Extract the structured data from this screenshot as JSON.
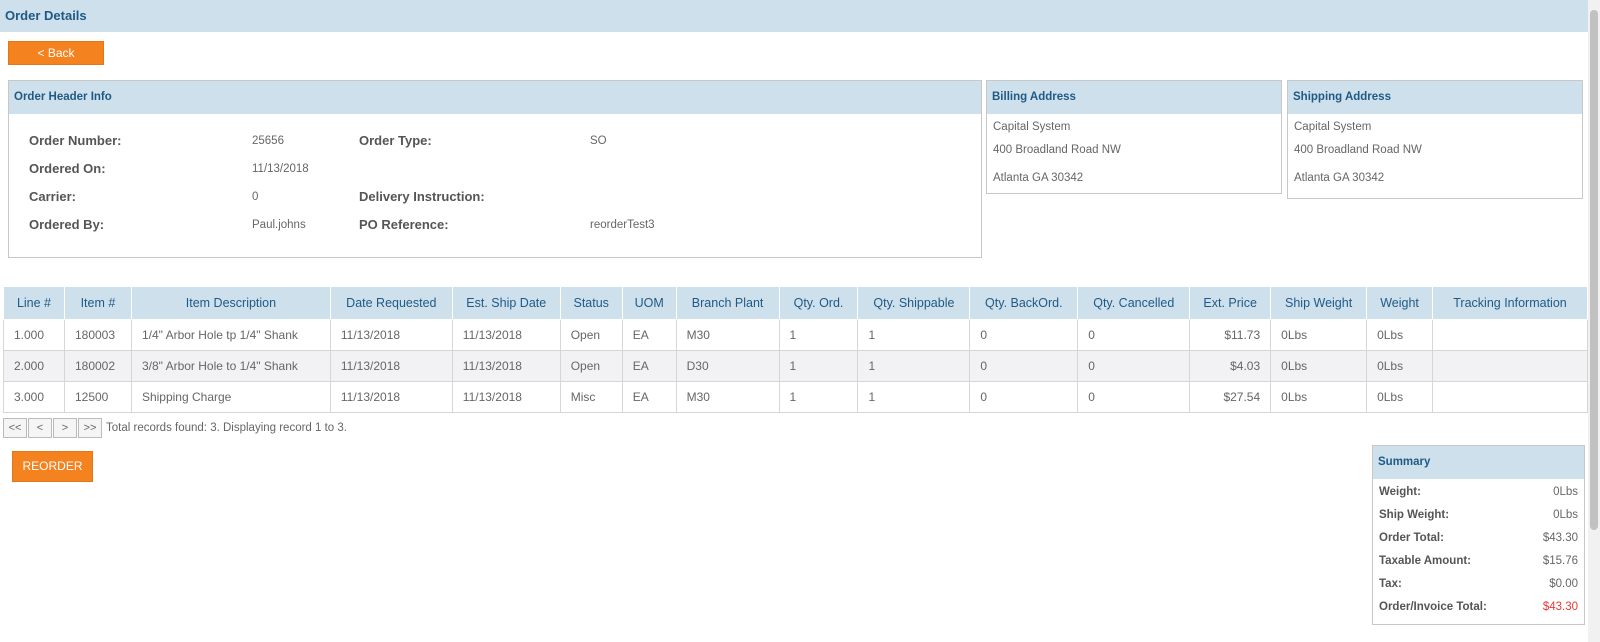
{
  "page_title": "Order Details",
  "back_label": "< Back",
  "header_info": {
    "title": "Order Header Info",
    "order_number_label": "Order Number:",
    "order_number": "25656",
    "order_type_label": "Order Type:",
    "order_type": "SO",
    "ordered_on_label": "Ordered On:",
    "ordered_on": "11/13/2018",
    "carrier_label": "Carrier:",
    "carrier": "0",
    "delivery_label": "Delivery Instruction:",
    "delivery": "",
    "ordered_by_label": "Ordered By:",
    "ordered_by": "Paul.johns",
    "po_label": "PO Reference:",
    "po": "reorderTest3"
  },
  "billing": {
    "title": "Billing Address",
    "name": "Capital System",
    "street": "400 Broadland Road NW",
    "city": "Atlanta GA 30342"
  },
  "shipping": {
    "title": "Shipping Address",
    "name": "Capital System",
    "street": "400 Broadland Road NW",
    "city": "Atlanta GA 30342"
  },
  "table": {
    "columns": [
      "Line #",
      "Item #",
      "Item Description",
      "Date Requested",
      "Est. Ship Date",
      "Status",
      "UOM",
      "Branch Plant",
      "Qty. Ord.",
      "Qty. Shippable",
      "Qty. BackOrd.",
      "Qty. Cancelled",
      "Ext. Price",
      "Ship Weight",
      "Weight",
      "Tracking Information"
    ],
    "rows": [
      [
        "1.000",
        "180003",
        "1/4\" Arbor Hole tp 1/4\" Shank",
        "11/13/2018",
        "11/13/2018",
        "Open",
        "EA",
        "M30",
        "1",
        "1",
        "0",
        "0",
        "$11.73",
        "0Lbs",
        "0Lbs",
        ""
      ],
      [
        "2.000",
        "180002",
        "3/8\" Arbor Hole to 1/4\" Shank",
        "11/13/2018",
        "11/13/2018",
        "Open",
        "EA",
        "D30",
        "1",
        "1",
        "0",
        "0",
        "$4.03",
        "0Lbs",
        "0Lbs",
        ""
      ],
      [
        "3.000",
        "12500",
        "Shipping Charge",
        "11/13/2018",
        "11/13/2018",
        "Misc",
        "EA",
        "M30",
        "1",
        "1",
        "0",
        "0",
        "$27.54",
        "0Lbs",
        "0Lbs",
        ""
      ]
    ]
  },
  "pager": {
    "first": "<<",
    "prev": "<",
    "next": ">",
    "last": ">>",
    "text": "Total records found: 3. Displaying record 1 to 3."
  },
  "reorder_label": "REORDER",
  "summary": {
    "title": "Summary",
    "weight_label": "Weight:",
    "weight": "0Lbs",
    "ship_weight_label": "Ship Weight:",
    "ship_weight": "0Lbs",
    "order_total_label": "Order Total:",
    "order_total": "$43.30",
    "taxable_label": "Taxable Amount:",
    "taxable": "$15.76",
    "tax_label": "Tax:",
    "tax": "$0.00",
    "invoice_total_label": "Order/Invoice Total:",
    "invoice_total": "$43.30",
    "invoice_total_color": "#e53935"
  }
}
